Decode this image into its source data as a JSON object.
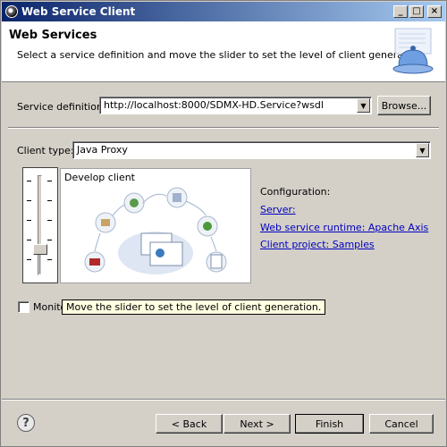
{
  "window": {
    "title": "Web Service Client"
  },
  "header": {
    "title": "Web Services",
    "description": "Select a service definition and move the slider to set the level of client generation."
  },
  "form": {
    "service_definition_label": "Service definition:",
    "service_definition_value": "http://localhost:8000/SDMX-HD.Service?wsdl",
    "browse_label": "Browse...",
    "client_type_label": "Client type:",
    "client_type_value": "Java Proxy"
  },
  "slider": {
    "level_label": "Develop client",
    "level_fraction": 0.2
  },
  "configuration": {
    "label": "Configuration:",
    "server_link": "Server: ",
    "runtime_link": "Web service runtime: Apache Axis",
    "project_link": "Client project: Samples"
  },
  "monitor": {
    "label_visible": "Monito",
    "checked": false
  },
  "tooltip": {
    "text": "Move the slider to set the level of client generation."
  },
  "footer": {
    "back_label": "< Back",
    "next_label": "Next >",
    "finish_label": "Finish",
    "cancel_label": "Cancel",
    "help_glyph": "?"
  },
  "icons": {
    "app": "eclipse-icon",
    "header": "service-bell-icon",
    "help": "help-icon"
  },
  "colors": {
    "titlebar_start": "#0a246a",
    "titlebar_end": "#a6caf0",
    "link": "#0000c0",
    "tooltip_bg": "#ffffe1",
    "slider_fill": "#6b8fd6"
  }
}
